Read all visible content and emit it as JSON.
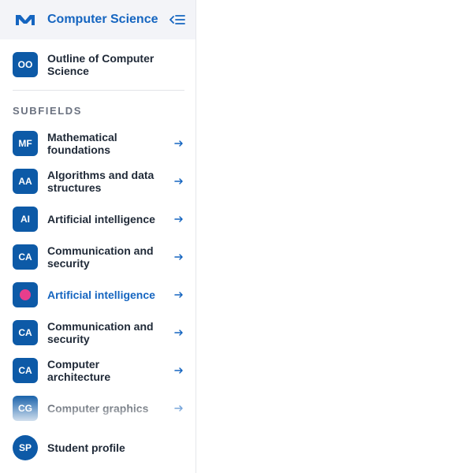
{
  "header": {
    "title": "Computer Science",
    "logo_icon": "m-logo-icon",
    "collapse_icon": "collapse-sidebar-icon"
  },
  "outline": {
    "badge": "OO",
    "label": "Outline of Computer Science"
  },
  "section_title": "SUBFIELDS",
  "subfields": [
    {
      "badge": "MF",
      "label": "Mathematical foundations"
    },
    {
      "badge": "AA",
      "label": "Algorithms and data structures"
    },
    {
      "badge": "AI",
      "label": "Artificial intelligence"
    },
    {
      "badge": "CA",
      "label": "Communication and security"
    },
    {
      "badge": "",
      "label": "Artificial intelligence",
      "active": true
    },
    {
      "badge": "CA",
      "label": "Communication and security"
    },
    {
      "badge": "CA",
      "label": "Computer architecture"
    },
    {
      "badge": "CG",
      "label": "Computer graphics"
    }
  ],
  "footer": {
    "avatar": "SP",
    "label": "Student profile"
  },
  "colors": {
    "accent": "#1565c0",
    "badge": "#0d5aa7",
    "active_dot": "#e83e8c"
  }
}
